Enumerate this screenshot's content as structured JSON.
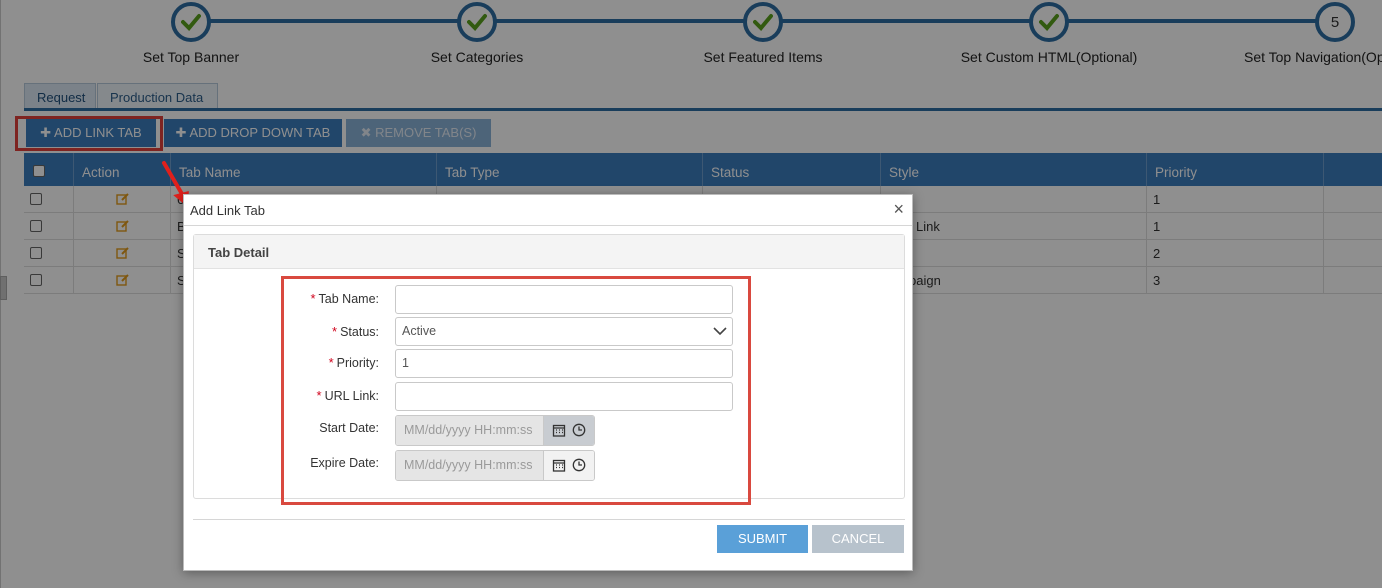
{
  "wizard": {
    "steps": [
      {
        "label": "Set Top Banner",
        "state": "done"
      },
      {
        "label": "Set Categories",
        "state": "done"
      },
      {
        "label": "Set Featured Items",
        "state": "done"
      },
      {
        "label": "Set Custom HTML(Optional)",
        "state": "done"
      },
      {
        "label": "Set Top Navigation(Op",
        "state": "current",
        "number": "5"
      }
    ]
  },
  "tabs": [
    {
      "label": "Request",
      "active": true
    },
    {
      "label": "Production Data",
      "active": false
    }
  ],
  "toolbar": {
    "add_link_tab": "✚ ADD LINK TAB",
    "add_drop_down_tab": "✚ ADD DROP DOWN TAB",
    "remove_tabs": "✖ REMOVE TAB(S)"
  },
  "grid": {
    "columns": [
      "Action",
      "Tab Name",
      "Tab Type",
      "Status",
      "Style",
      "Priority"
    ],
    "rows": [
      {
        "tab_name": "6",
        "tab_type": "",
        "status": "",
        "style": "",
        "priority": "1"
      },
      {
        "tab_name": "B",
        "tab_type": "",
        "status": "",
        "style": "Link",
        "priority": "1"
      },
      {
        "tab_name": "S",
        "tab_type": "",
        "status": "",
        "style": "",
        "priority": "2"
      },
      {
        "tab_name": "S",
        "tab_type": "",
        "status": "",
        "style": "paign",
        "priority": "3"
      }
    ]
  },
  "modal": {
    "title": "Add Link Tab",
    "close": "×",
    "panel_title": "Tab Detail",
    "fields": {
      "tab_name": {
        "label": "Tab Name:",
        "required": "*",
        "value": ""
      },
      "status": {
        "label": "Status:",
        "required": "*",
        "value": "Active"
      },
      "priority": {
        "label": "Priority:",
        "required": "*",
        "value": "1"
      },
      "url_link": {
        "label": "URL Link:",
        "required": "*",
        "value": ""
      },
      "start_date": {
        "label": "Start Date:",
        "placeholder": "MM/dd/yyyy HH:mm:ss"
      },
      "expire_date": {
        "label": "Expire Date:",
        "placeholder": "MM/dd/yyyy HH:mm:ss"
      }
    },
    "submit": "SUBMIT",
    "cancel": "CANCEL"
  },
  "colors": {
    "primary": "#3c7dbe",
    "wizard": "#2d6da3",
    "check": "#5aa01e",
    "highlight": "#e0403c",
    "submit": "#5aa0d8",
    "cancel": "#b7c2cc"
  },
  "icons": [
    "check-icon",
    "edit-icon",
    "calendar-icon",
    "clock-icon",
    "chevron-down-icon",
    "close-icon",
    "red-arrow"
  ]
}
